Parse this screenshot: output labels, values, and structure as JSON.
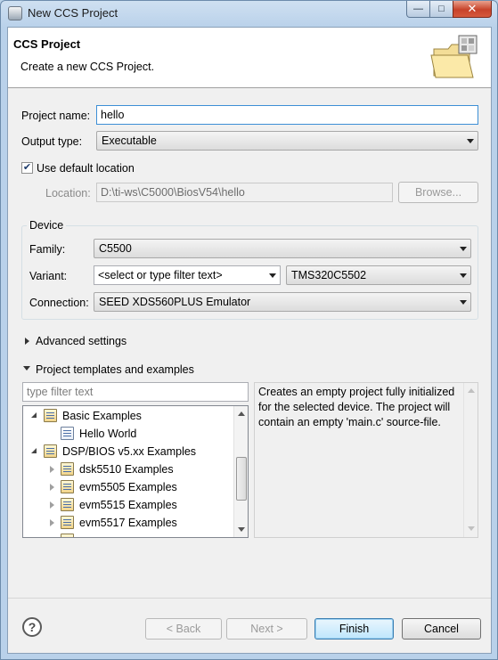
{
  "window": {
    "title": "New CCS Project",
    "caption_buttons": {
      "minimize": "—",
      "maximize": "□",
      "close": "✕"
    }
  },
  "banner": {
    "title": "CCS Project",
    "description": "Create a new CCS Project."
  },
  "form": {
    "project_name_label": "Project name:",
    "project_name_value": "hello",
    "output_type_label": "Output type:",
    "output_type_value": "Executable",
    "use_default_location_label": "Use default location",
    "use_default_location_checked": true,
    "location_label": "Location:",
    "location_value": "D:\\ti-ws\\C5000\\BiosV54\\hello",
    "browse_label": "Browse..."
  },
  "device": {
    "group_label": "Device",
    "family_label": "Family:",
    "family_value": "C5500",
    "variant_label": "Variant:",
    "variant_filter_placeholder": "<select or type filter text>",
    "variant_value": "TMS320C5502",
    "connection_label": "Connection:",
    "connection_value": "SEED XDS560PLUS Emulator"
  },
  "advanced": {
    "label": "Advanced settings",
    "expanded": false
  },
  "templates": {
    "label": "Project templates and examples",
    "expanded": true,
    "filter_placeholder": "type filter text",
    "tree": [
      {
        "label": "Basic Examples",
        "level": 0,
        "expanded": true,
        "icon": "template-folder-icon"
      },
      {
        "label": "Hello World",
        "level": 1,
        "expanded": null,
        "icon": "template-item-icon"
      },
      {
        "label": "DSP/BIOS v5.xx Examples",
        "level": 0,
        "expanded": true,
        "icon": "template-folder-icon"
      },
      {
        "label": "dsk5510 Examples",
        "level": 1,
        "expanded": false,
        "icon": "template-folder-icon"
      },
      {
        "label": "evm5505 Examples",
        "level": 1,
        "expanded": false,
        "icon": "template-folder-icon"
      },
      {
        "label": "evm5515 Examples",
        "level": 1,
        "expanded": false,
        "icon": "template-folder-icon"
      },
      {
        "label": "evm5517 Examples",
        "level": 1,
        "expanded": false,
        "icon": "template-folder-icon"
      }
    ],
    "description": "Creates an empty project fully initialized for the selected device. The project will contain an empty 'main.c' source-file."
  },
  "footer": {
    "help_label": "?",
    "back_label": "< Back",
    "next_label": "Next >",
    "finish_label": "Finish",
    "cancel_label": "Cancel"
  }
}
